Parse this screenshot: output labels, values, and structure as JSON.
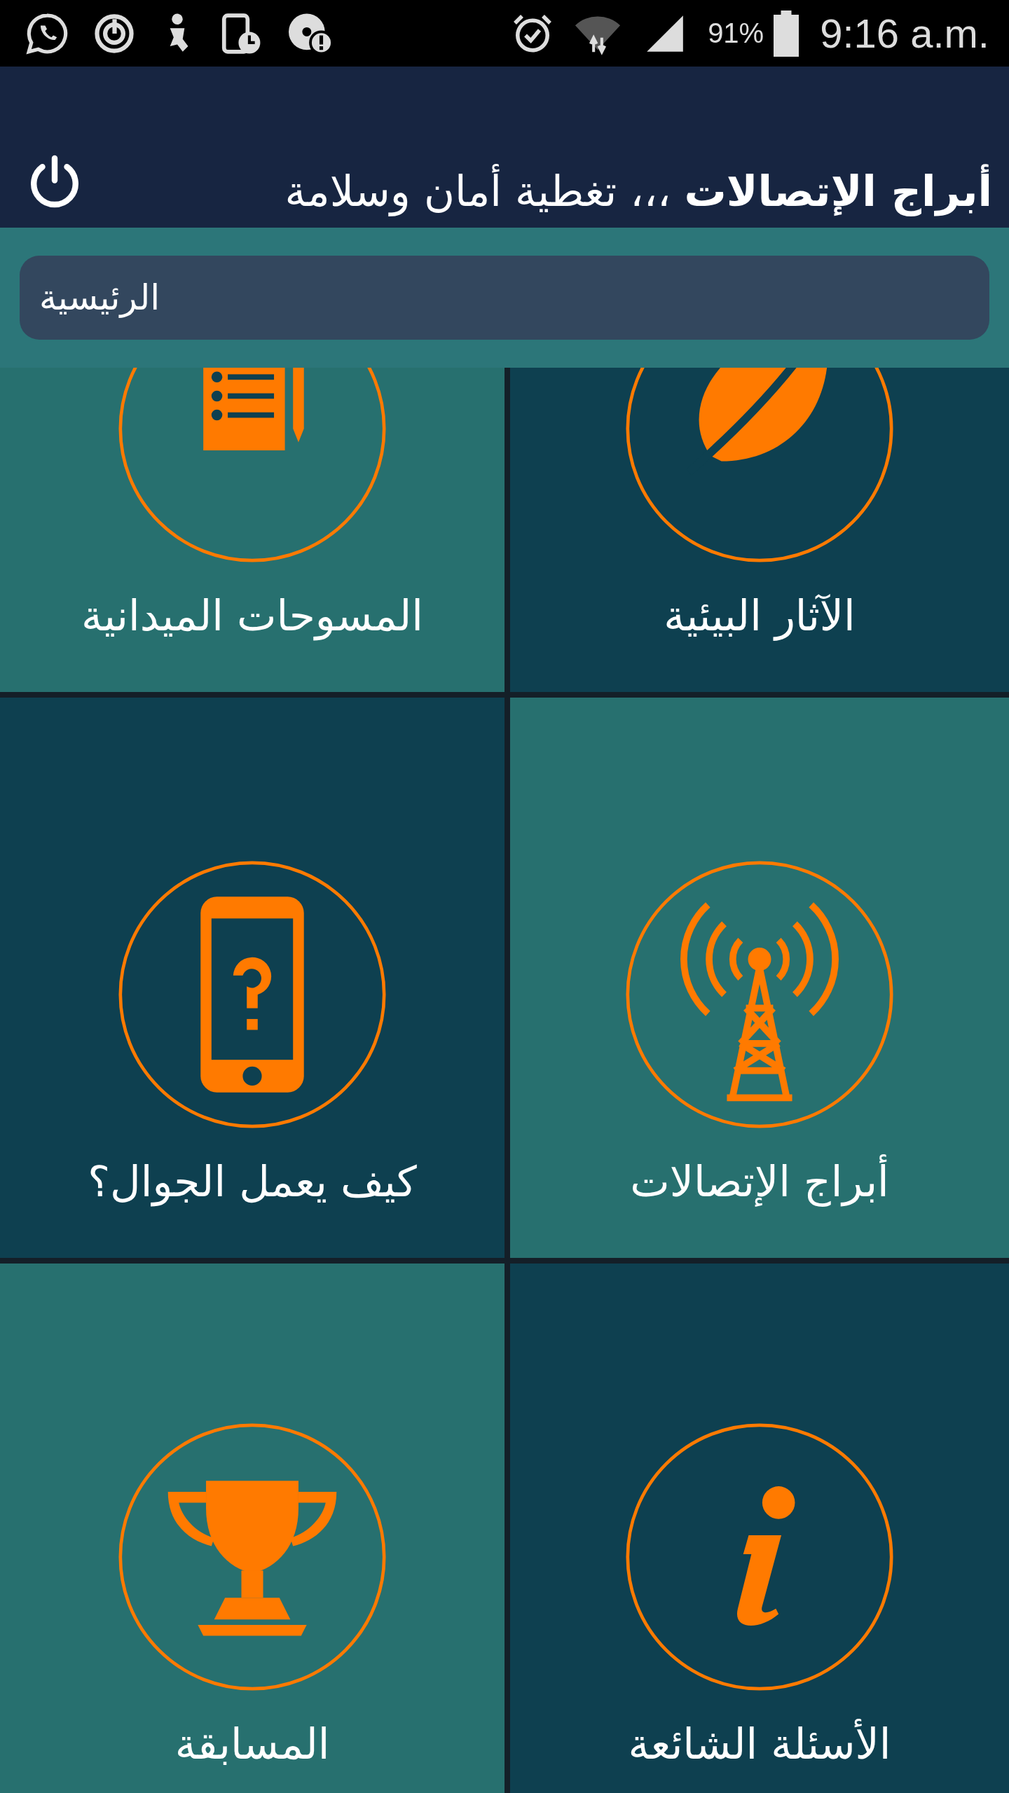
{
  "status_bar": {
    "battery": "91%",
    "time": "9:16 a.m."
  },
  "header": {
    "title": "**أبراج الإتصالات** ،،، تغطية أمان وسلامة"
  },
  "section": {
    "label": "الرئيسية"
  },
  "tiles": [
    {
      "label": "الآثار البيئية",
      "kind": "leaf",
      "color": "#0e4050"
    },
    {
      "label": "المسوحات الميدانية",
      "kind": "clipboard",
      "color": "#27706f"
    },
    {
      "label": "أبراج الإتصالات",
      "kind": "tower",
      "color": "#27706f"
    },
    {
      "label": "كيف يعمل الجوال؟",
      "kind": "phone",
      "color": "#0e4050"
    },
    {
      "label": "الأسئلة الشائعة",
      "kind": "info",
      "color": "#0e4050"
    },
    {
      "label": "المسابقة",
      "kind": "trophy",
      "color": "#27706f"
    }
  ]
}
